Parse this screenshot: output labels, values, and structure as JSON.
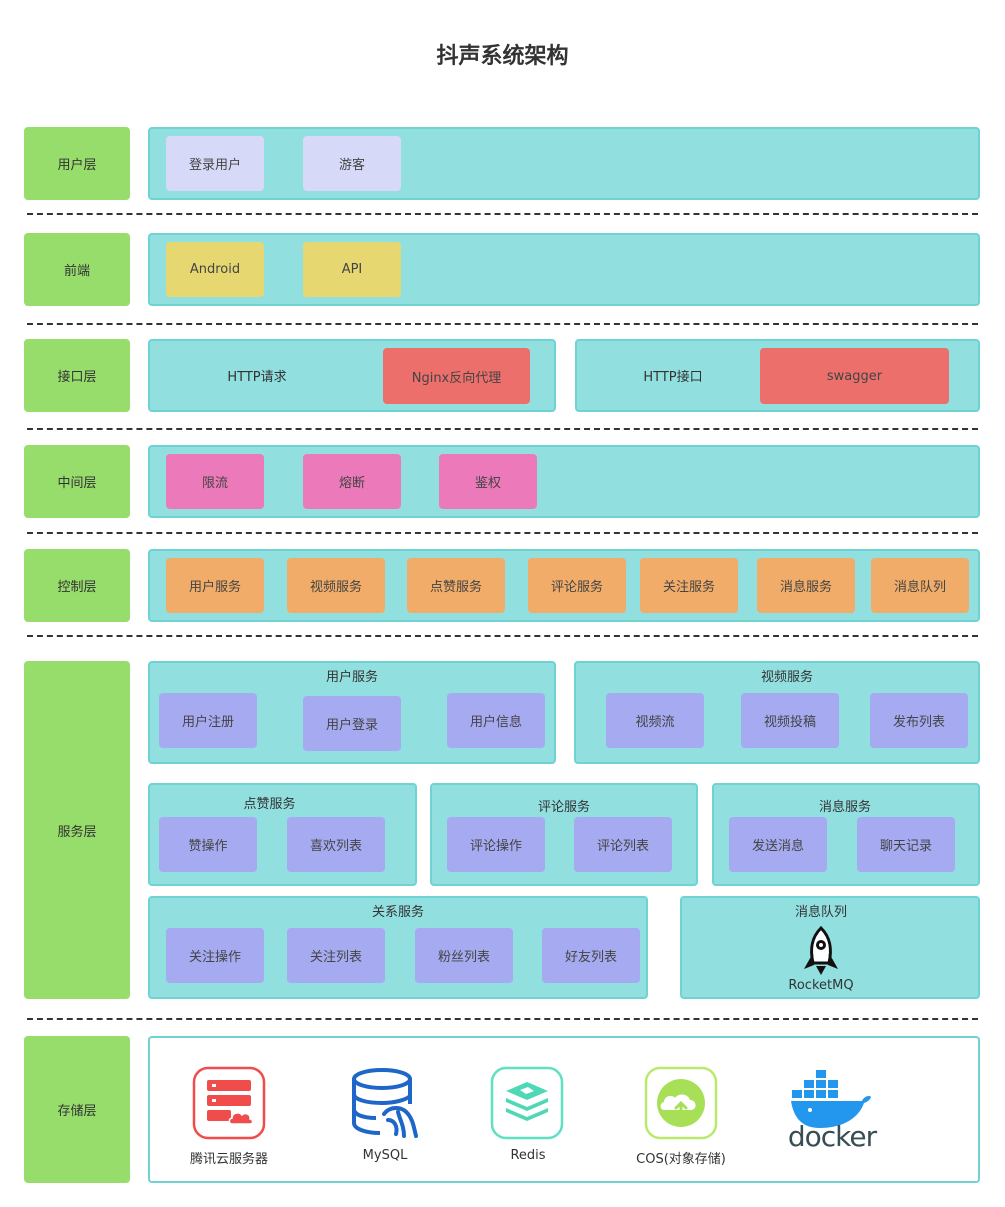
{
  "title": "抖声系统架构",
  "layers": {
    "user": "用户层",
    "frontend": "前端",
    "interface": "接口层",
    "middle": "中间层",
    "control": "控制层",
    "service": "服务层",
    "storage": "存储层"
  },
  "user_layer": {
    "items": [
      "登录用户",
      "游客"
    ]
  },
  "frontend_layer": {
    "items": [
      "Android",
      "API"
    ]
  },
  "interface_layer": {
    "left": {
      "label": "HTTP请求",
      "box": "Nginx反向代理"
    },
    "right": {
      "label": "HTTP接口",
      "box": "swagger"
    }
  },
  "middle_layer": {
    "items": [
      "限流",
      "熔断",
      "鉴权"
    ]
  },
  "control_layer": {
    "items": [
      "用户服务",
      "视频服务",
      "点赞服务",
      "评论服务",
      "关注服务",
      "消息服务",
      "消息队列"
    ]
  },
  "service_layer": {
    "user_service": {
      "title": "用户服务",
      "items": [
        "用户注册",
        "用户登录",
        "用户信息"
      ]
    },
    "video_service": {
      "title": "视频服务",
      "items": [
        "视频流",
        "视频投稿",
        "发布列表"
      ]
    },
    "like_service": {
      "title": "点赞服务",
      "items": [
        "赞操作",
        "喜欢列表"
      ]
    },
    "comment_service": {
      "title": "评论服务",
      "items": [
        "评论操作",
        "评论列表"
      ]
    },
    "message_service": {
      "title": "消息服务",
      "items": [
        "发送消息",
        "聊天记录"
      ]
    },
    "relation_service": {
      "title": "关系服务",
      "items": [
        "关注操作",
        "关注列表",
        "粉丝列表",
        "好友列表"
      ]
    },
    "message_queue": {
      "title": "消息队列",
      "caption": "RocketMQ"
    }
  },
  "storage_layer": {
    "items": [
      {
        "label": "腾讯云服务器",
        "icon": "tencent-cloud-server-icon"
      },
      {
        "label": "MySQL",
        "icon": "mysql-icon"
      },
      {
        "label": "Redis",
        "icon": "redis-icon"
      },
      {
        "label": "COS(对象存储)",
        "icon": "cos-icon"
      },
      {
        "label": "docker",
        "icon": "docker-icon"
      }
    ]
  },
  "colors": {
    "layer_green": "#97dd6b",
    "panel_cyan": "#92dfe0",
    "user_lavender": "#d6d9f7",
    "frontend_yellow": "#e7d770",
    "interface_red": "#ec6f6b",
    "middle_pink": "#ec79b9",
    "control_orange": "#f0ac68",
    "service_blue": "#a5aaf1"
  }
}
